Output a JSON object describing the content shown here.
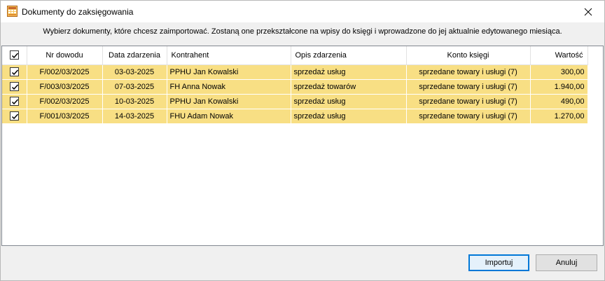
{
  "window": {
    "title": "Dokumenty do zaksięgowania",
    "close_symbol": "✕"
  },
  "instruction": "Wybierz dokumenty, które chcesz zaimportować. Zostaną one przekształcone na wpisy do księgi i wprowadzone do jej aktualnie edytowanego miesiąca.",
  "table": {
    "columns": [
      "Nr dowodu",
      "Data zdarzenia",
      "Kontrahent",
      "Opis zdarzenia",
      "Konto księgi",
      "Wartość"
    ],
    "header_checked": true,
    "rows": [
      {
        "checked": true,
        "nr": "F/002/03/2025",
        "data": "03-03-2025",
        "kontrahent": "PPHU Jan Kowalski",
        "opis": "sprzedaż usług",
        "konto": "sprzedane towary i usługi (7)",
        "wartosc": "300,00"
      },
      {
        "checked": true,
        "nr": "F/003/03/2025",
        "data": "07-03-2025",
        "kontrahent": "FH Anna Nowak",
        "opis": "sprzedaż towarów",
        "konto": "sprzedane towary i usługi (7)",
        "wartosc": "1.940,00"
      },
      {
        "checked": true,
        "nr": "F/002/03/2025",
        "data": "10-03-2025",
        "kontrahent": "PPHU Jan Kowalski",
        "opis": "sprzedaż usług",
        "konto": "sprzedane towary i usługi (7)",
        "wartosc": "490,00"
      },
      {
        "checked": true,
        "nr": "F/001/03/2025",
        "data": "14-03-2025",
        "kontrahent": "FHU Adam Nowak",
        "opis": "sprzedaż usług",
        "konto": "sprzedane towary i usługi (7)",
        "wartosc": "1.270,00"
      }
    ],
    "row_highlight_color": "#f8df84"
  },
  "buttons": {
    "import_label": "Importuj",
    "cancel_label": "Anuluj"
  },
  "colors": {
    "accent": "#0078d7"
  }
}
